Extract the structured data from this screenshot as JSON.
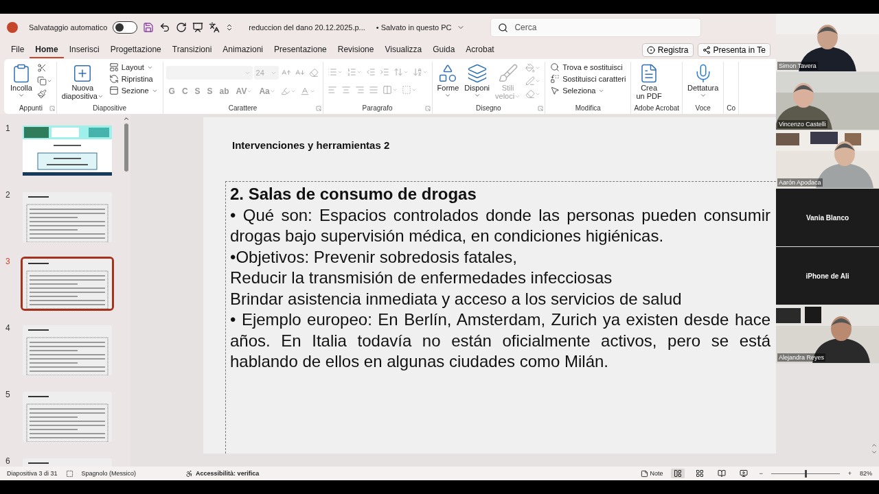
{
  "title_bar": {
    "autosave_label": "Salvataggio automatico",
    "autosave_on": false,
    "file_name": "reduccion del dano  20.12.2025.p...",
    "save_status": "• Salvato in questo PC",
    "search": {
      "placeholder": "Cerca"
    }
  },
  "menu_tabs": [
    {
      "label": "File",
      "selected": false
    },
    {
      "label": "Home",
      "selected": true
    },
    {
      "label": "Inserisci",
      "selected": false
    },
    {
      "label": "Progettazione",
      "selected": false
    },
    {
      "label": "Transizioni",
      "selected": false
    },
    {
      "label": "Animazioni",
      "selected": false
    },
    {
      "label": "Presentazione",
      "selected": false
    },
    {
      "label": "Revisione",
      "selected": false
    },
    {
      "label": "Visualizza",
      "selected": false
    },
    {
      "label": "Guida",
      "selected": false
    },
    {
      "label": "Acrobat",
      "selected": false
    }
  ],
  "header_buttons": [
    {
      "label": "Registra",
      "kind": "record"
    },
    {
      "label": "Presenta in Te",
      "kind": "share"
    }
  ],
  "ribbon": [
    {
      "label": "Appunti",
      "kind": "columns",
      "launcher": true,
      "sets": [
        [
          {
            "kind": "large",
            "label": [
              "Incolla"
            ],
            "caret": true,
            "disabled": false
          }
        ],
        [
          {
            "kind": "icon",
            "caret": false,
            "disabled": false
          },
          {
            "kind": "icon",
            "caret": true,
            "disabled": false
          },
          {
            "kind": "icon",
            "caret": false,
            "disabled": false
          }
        ]
      ]
    },
    {
      "label": "Diapositive",
      "kind": "columns",
      "launcher": false,
      "sets": [
        [
          {
            "kind": "large",
            "label": [
              "Nuova",
              "diapositiva"
            ],
            "caret": true,
            "disabled": false
          }
        ],
        [
          {
            "kind": "small",
            "label": "Layout",
            "caret": true,
            "disabled": false
          },
          {
            "kind": "small",
            "label": "Ripristina",
            "caret": false,
            "disabled": false
          },
          {
            "kind": "small",
            "label": "Sezione",
            "caret": true,
            "disabled": false
          }
        ]
      ]
    },
    {
      "label": "Carattere",
      "kind": "rows",
      "launcher": true,
      "sets": [
        [
          {
            "kind": "font-field",
            "disabled": true
          },
          {
            "kind": "size-field",
            "value": "24",
            "disabled": true
          },
          {
            "kind": "icon",
            "caret": false,
            "disabled": true
          },
          {
            "kind": "icon",
            "caret": false,
            "disabled": true
          },
          {
            "kind": "icon",
            "caret": false,
            "disabled": true
          }
        ],
        [
          {
            "kind": "letter",
            "label": "G",
            "caret": false,
            "disabled": true
          },
          {
            "kind": "letter",
            "label": "C",
            "caret": false,
            "disabled": true
          },
          {
            "kind": "letter",
            "label": "S",
            "caret": false,
            "disabled": true
          },
          {
            "kind": "letter",
            "label": "S",
            "caret": false,
            "disabled": true
          },
          {
            "kind": "letter",
            "label": "ab",
            "caret": false,
            "disabled": true
          },
          {
            "kind": "letter",
            "label": "AV",
            "caret": true,
            "disabled": true
          },
          {
            "kind": "letter",
            "label": "Aa",
            "caret": true,
            "disabled": true
          },
          {
            "kind": "icon",
            "caret": true,
            "disabled": true
          },
          {
            "kind": "icon",
            "caret": true,
            "disabled": true
          }
        ]
      ]
    },
    {
      "label": "Paragrafo",
      "kind": "rows",
      "launcher": true,
      "sets": [
        [
          {
            "kind": "icon",
            "caret": true,
            "disabled": true
          },
          {
            "kind": "icon",
            "caret": true,
            "disabled": true
          },
          {
            "kind": "icon",
            "caret": false,
            "disabled": true
          },
          {
            "kind": "icon",
            "caret": false,
            "disabled": true
          },
          {
            "kind": "icon",
            "caret": true,
            "disabled": true
          },
          {
            "kind": "icon",
            "caret": true,
            "disabled": true
          }
        ],
        [
          {
            "kind": "icon",
            "caret": false,
            "disabled": true
          },
          {
            "kind": "icon",
            "caret": false,
            "disabled": true
          },
          {
            "kind": "icon",
            "caret": false,
            "disabled": true
          },
          {
            "kind": "icon",
            "caret": false,
            "disabled": true
          },
          {
            "kind": "icon",
            "caret": true,
            "disabled": true
          },
          {
            "kind": "icon",
            "caret": true,
            "disabled": true
          }
        ]
      ]
    },
    {
      "label": "Disegno",
      "kind": "columns",
      "launcher": true,
      "sets": [
        [
          {
            "kind": "large",
            "label": [
              "Forme"
            ],
            "caret": true,
            "disabled": false
          }
        ],
        [
          {
            "kind": "large",
            "label": [
              "Disponi"
            ],
            "caret": true,
            "disabled": false
          }
        ],
        [
          {
            "kind": "large",
            "label": [
              "Stili",
              "veloci"
            ],
            "caret": true,
            "disabled": true
          }
        ],
        [
          {
            "kind": "icon",
            "caret": true,
            "disabled": true
          },
          {
            "kind": "icon",
            "caret": true,
            "disabled": true
          },
          {
            "kind": "icon",
            "caret": true,
            "disabled": true
          }
        ]
      ]
    },
    {
      "label": "Modifica",
      "kind": "columns",
      "launcher": false,
      "sets": [
        [
          {
            "kind": "small",
            "label": "Trova e sostituisci",
            "caret": false,
            "disabled": false
          },
          {
            "kind": "small",
            "label": "Sostituisci caratteri",
            "caret": false,
            "disabled": false
          },
          {
            "kind": "small",
            "label": "Seleziona",
            "caret": true,
            "disabled": false
          }
        ]
      ]
    },
    {
      "label": "Adobe Acrobat",
      "kind": "columns",
      "launcher": false,
      "sets": [
        [
          {
            "kind": "large",
            "label": [
              "Crea",
              "un PDF"
            ],
            "caret": false,
            "disabled": false
          }
        ]
      ]
    },
    {
      "label": "Voce",
      "kind": "columns",
      "launcher": false,
      "sets": [
        [
          {
            "kind": "large",
            "label": [
              "Dettatura"
            ],
            "caret": true,
            "disabled": false
          }
        ]
      ]
    },
    {
      "label": "Co",
      "kind": "columns",
      "launcher": false
    }
  ],
  "slides": [
    {
      "number": "1",
      "kind": "cover",
      "selected": false
    },
    {
      "number": "2",
      "kind": "text",
      "selected": false
    },
    {
      "number": "3",
      "kind": "text",
      "selected": true
    },
    {
      "number": "4",
      "kind": "text",
      "selected": false
    },
    {
      "number": "5",
      "kind": "text",
      "selected": false
    },
    {
      "number": "6",
      "kind": "text",
      "selected": false
    }
  ],
  "slide": {
    "title": "Intervenciones y herramientas 2",
    "body": [
      {
        "kind": "heading",
        "text": "2. Salas de consumo de drogas"
      },
      {
        "kind": "justified",
        "text": "• Qué son: Espacios controlados donde las personas pueden consumir drogas bajo supervisión médica, en condiciones higiénicas."
      },
      {
        "kind": "plain",
        "text": "•Objetivos: Prevenir sobredosis fatales,"
      },
      {
        "kind": "plain",
        "text": "Reducir la transmisión de enfermedades infecciosas"
      },
      {
        "kind": "plain",
        "text": "Brindar asistencia inmediata y acceso a los servicios de salud"
      },
      {
        "kind": "justified",
        "text": "• Ejemplo europeo: En Berlín, Amsterdam, Zurich ya existen desde hace años. En Italia todavía no están oficialmente activos, pero se está hablando de ellos en algunas ciudades como Milán."
      }
    ]
  },
  "participants": [
    {
      "name": "Simon Tavera",
      "camera_on": true
    },
    {
      "name": "Vincenzo Castelli",
      "camera_on": true
    },
    {
      "name": "Aarón Apodaca",
      "camera_on": true
    },
    {
      "name": "Vania Blanco",
      "camera_on": false
    },
    {
      "name": "iPhone de Ali",
      "camera_on": false
    },
    {
      "name": "Alejandra Reyes",
      "camera_on": true
    }
  ],
  "status_bar": {
    "slide_counter": "Diapositiva 3 di 31",
    "language": "Spagnolo (Messico)",
    "accessibility": "Accessibilità: verifica",
    "notes": "Note",
    "views": [
      {
        "selected": true
      },
      {
        "selected": false
      },
      {
        "selected": false
      },
      {
        "selected": false
      }
    ],
    "zoom": {
      "minus": "−",
      "level": 0.5,
      "plus": "+",
      "reading": "82%"
    }
  }
}
